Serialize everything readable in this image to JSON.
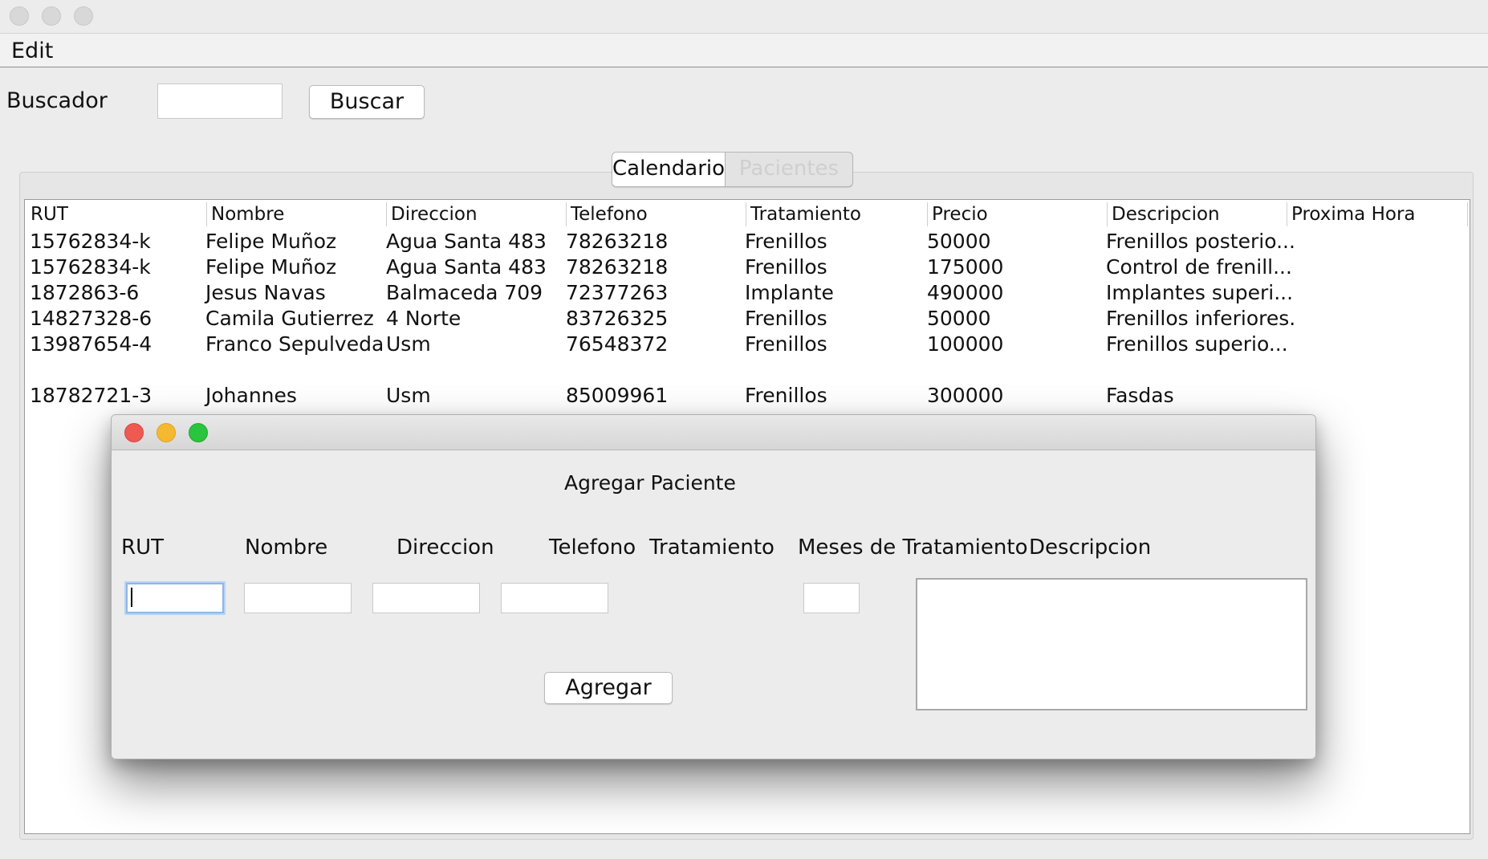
{
  "menu": {
    "edit": "Edit"
  },
  "search": {
    "label": "Buscador",
    "value": "",
    "button": "Buscar"
  },
  "tabs": [
    {
      "label": "Calendario",
      "active": true
    },
    {
      "label": "Pacientes",
      "active": false
    }
  ],
  "table": {
    "headers": [
      "RUT",
      "Nombre",
      "Direccion",
      "Telefono",
      "Tratamiento",
      "Precio",
      "Descripcion",
      "Proxima Hora"
    ],
    "rows": [
      [
        "15762834-k",
        "Felipe Muñoz",
        "Agua Santa 483",
        "78263218",
        "Frenillos",
        "50000",
        "Frenillos posterio...",
        ""
      ],
      [
        "15762834-k",
        "Felipe Muñoz",
        "Agua Santa 483",
        "78263218",
        "Frenillos",
        "175000",
        "Control de frenill...",
        ""
      ],
      [
        "1872863-6",
        "Jesus Navas",
        "Balmaceda 709",
        "72377263",
        "Implante",
        "490000",
        "Implantes superi...",
        ""
      ],
      [
        "14827328-6",
        "Camila Gutierrez",
        "4 Norte",
        "83726325",
        "Frenillos",
        "50000",
        "Frenillos inferiores.",
        ""
      ],
      [
        "13987654-4",
        "Franco Sepulveda",
        "Usm",
        "76548372",
        "Frenillos",
        "100000",
        "Frenillos superio...",
        ""
      ],
      [
        "",
        "",
        "",
        "",
        "",
        "",
        "",
        ""
      ],
      [
        "18782721-3",
        "Johannes",
        "Usm",
        "85009961",
        "Frenillos",
        "300000",
        "Fasdas",
        ""
      ]
    ]
  },
  "dialog": {
    "title": "Agregar Paciente",
    "labels": {
      "rut": "RUT",
      "nombre": "Nombre",
      "direccion": "Direccion",
      "telefono": "Telefono",
      "tratamiento": "Tratamiento",
      "meses": "Meses de Tratamiento",
      "descripcion": "Descripcion"
    },
    "values": {
      "rut": "",
      "nombre": "",
      "direccion": "",
      "telefono": "",
      "meses": "",
      "descripcion": ""
    },
    "button": "Agregar"
  },
  "colors": {
    "close": "#ee5a52",
    "minimize": "#f5b931",
    "maximize": "#2bc43f",
    "inactive_light": "#d8d8d8"
  }
}
